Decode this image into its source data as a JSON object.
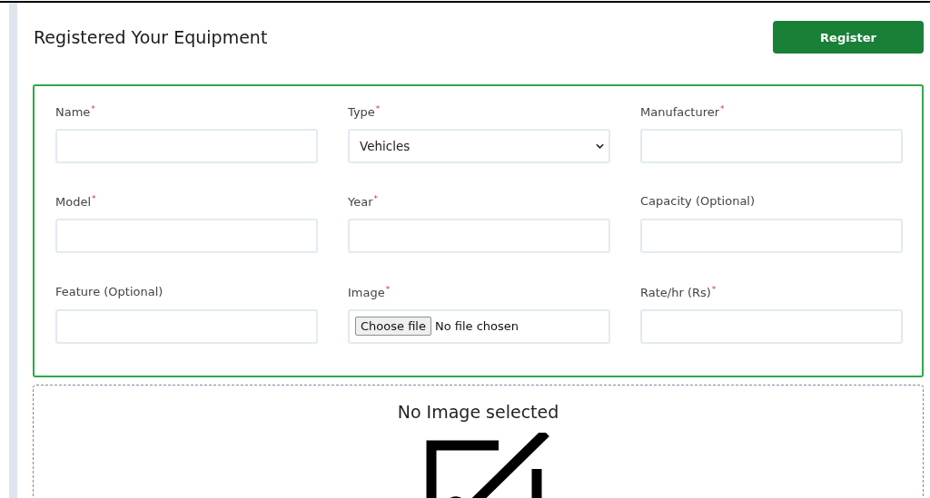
{
  "header": {
    "title": "Registered Your Equipment",
    "button": "Register"
  },
  "form": {
    "fields": [
      {
        "label": "Name",
        "mark": "*",
        "kind": "text"
      },
      {
        "label": "Type",
        "mark": "*",
        "kind": "select",
        "value": "Vehicles"
      },
      {
        "label": "Manufacturer",
        "mark": "*",
        "kind": "text"
      },
      {
        "label": "Model",
        "mark": "*",
        "kind": "text"
      },
      {
        "label": "Year",
        "mark": "*",
        "kind": "text"
      },
      {
        "label": "Capacity (Optional)",
        "kind": "text"
      },
      {
        "label": "Feature (Optional)",
        "kind": "text"
      },
      {
        "label": "Image",
        "mark": "*",
        "kind": "file",
        "button": "Choose file",
        "status": "No file chosen"
      },
      {
        "label": "Rate/hr (Rs)",
        "mark": "*",
        "kind": "text"
      }
    ]
  },
  "preview": {
    "message": "No Image selected"
  }
}
